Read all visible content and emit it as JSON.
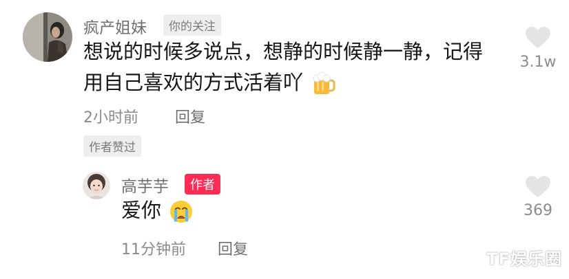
{
  "comment": {
    "username": "疯产姐妹",
    "relation_badge": "你的关注",
    "text_line1": "想说的时候多说点，想静的时候静一静，记得",
    "text_line2": "用自己喜欢的方式活着吖",
    "emoji": "beer-mug-emoji",
    "time": "2小时前",
    "reply_label": "回复",
    "author_liked_badge": "作者赞过",
    "like_count": "3.1w"
  },
  "reply": {
    "username": "高芋芋",
    "author_badge": "作者",
    "text": "爱你",
    "emoji": "crying-face-emoji",
    "time": "11分钟前",
    "reply_label": "回复",
    "like_count": "369"
  },
  "watermark": "TF娱乐圈",
  "colors": {
    "author_badge_bg": "#fe2c55",
    "text_primary": "#161616",
    "text_secondary": "#8a8a8a",
    "badge_bg": "#eeeeee"
  }
}
